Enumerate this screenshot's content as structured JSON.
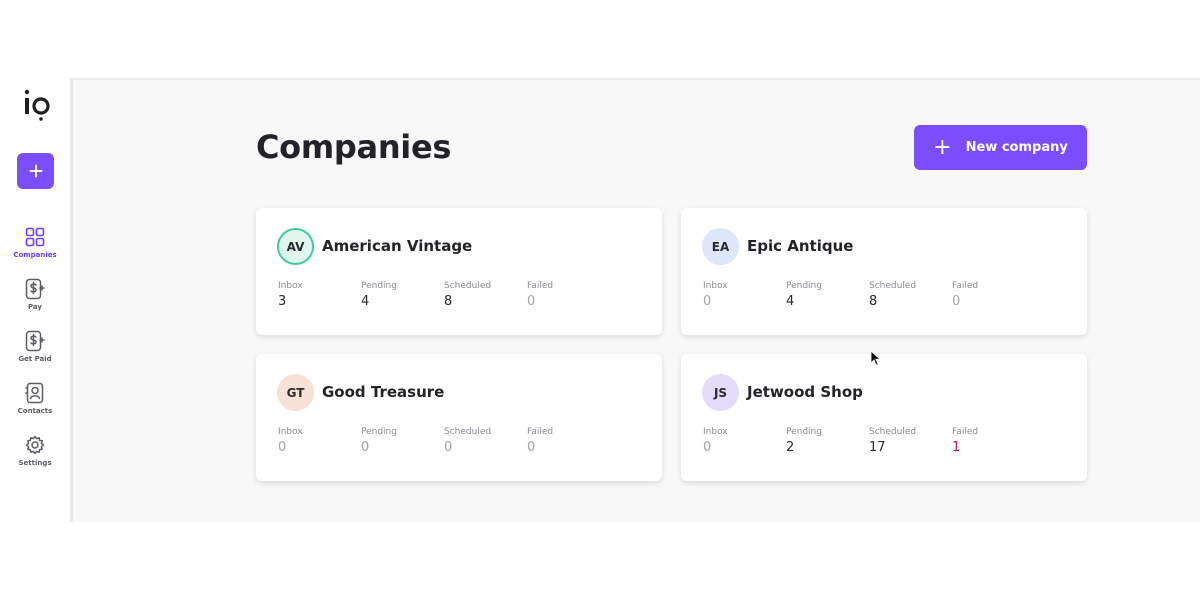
{
  "sidebar": {
    "logo_text": "io",
    "add_label": "+",
    "items": [
      {
        "label": "Companies",
        "icon": "grid-icon",
        "active": true
      },
      {
        "label": "Pay",
        "icon": "dollar-send-icon",
        "active": false
      },
      {
        "label": "Get Paid",
        "icon": "dollar-receive-icon",
        "active": false
      },
      {
        "label": "Contacts",
        "icon": "contact-card-icon",
        "active": false
      },
      {
        "label": "Settings",
        "icon": "gear-icon",
        "active": false
      }
    ]
  },
  "main": {
    "title": "Companies",
    "new_company_label": "New company",
    "stat_labels": [
      "Inbox",
      "Pending",
      "Scheduled",
      "Failed"
    ],
    "companies": [
      {
        "initials": "AV",
        "name": "American Vintage",
        "avatar_bg": "#e3f6ee",
        "avatar_border": "#3dcf9a",
        "stats": [
          "3",
          "4",
          "8",
          "0"
        ]
      },
      {
        "initials": "EA",
        "name": "Epic Antique",
        "avatar_bg": "#dde6fb",
        "avatar_border": "#dde6fb",
        "stats": [
          "0",
          "4",
          "8",
          "0"
        ]
      },
      {
        "initials": "GT",
        "name": "Good Treasure",
        "avatar_bg": "#f8e1d6",
        "avatar_border": "#f8e1d6",
        "stats": [
          "0",
          "0",
          "0",
          "0"
        ]
      },
      {
        "initials": "JS",
        "name": "Jetwood Shop",
        "avatar_bg": "#e3dcfa",
        "avatar_border": "#e3dcfa",
        "stats": [
          "0",
          "2",
          "17",
          "1"
        ]
      }
    ]
  },
  "colors": {
    "accent": "#7b4dff",
    "active_nav": "#6c3cff",
    "failed": "#d3184c"
  }
}
